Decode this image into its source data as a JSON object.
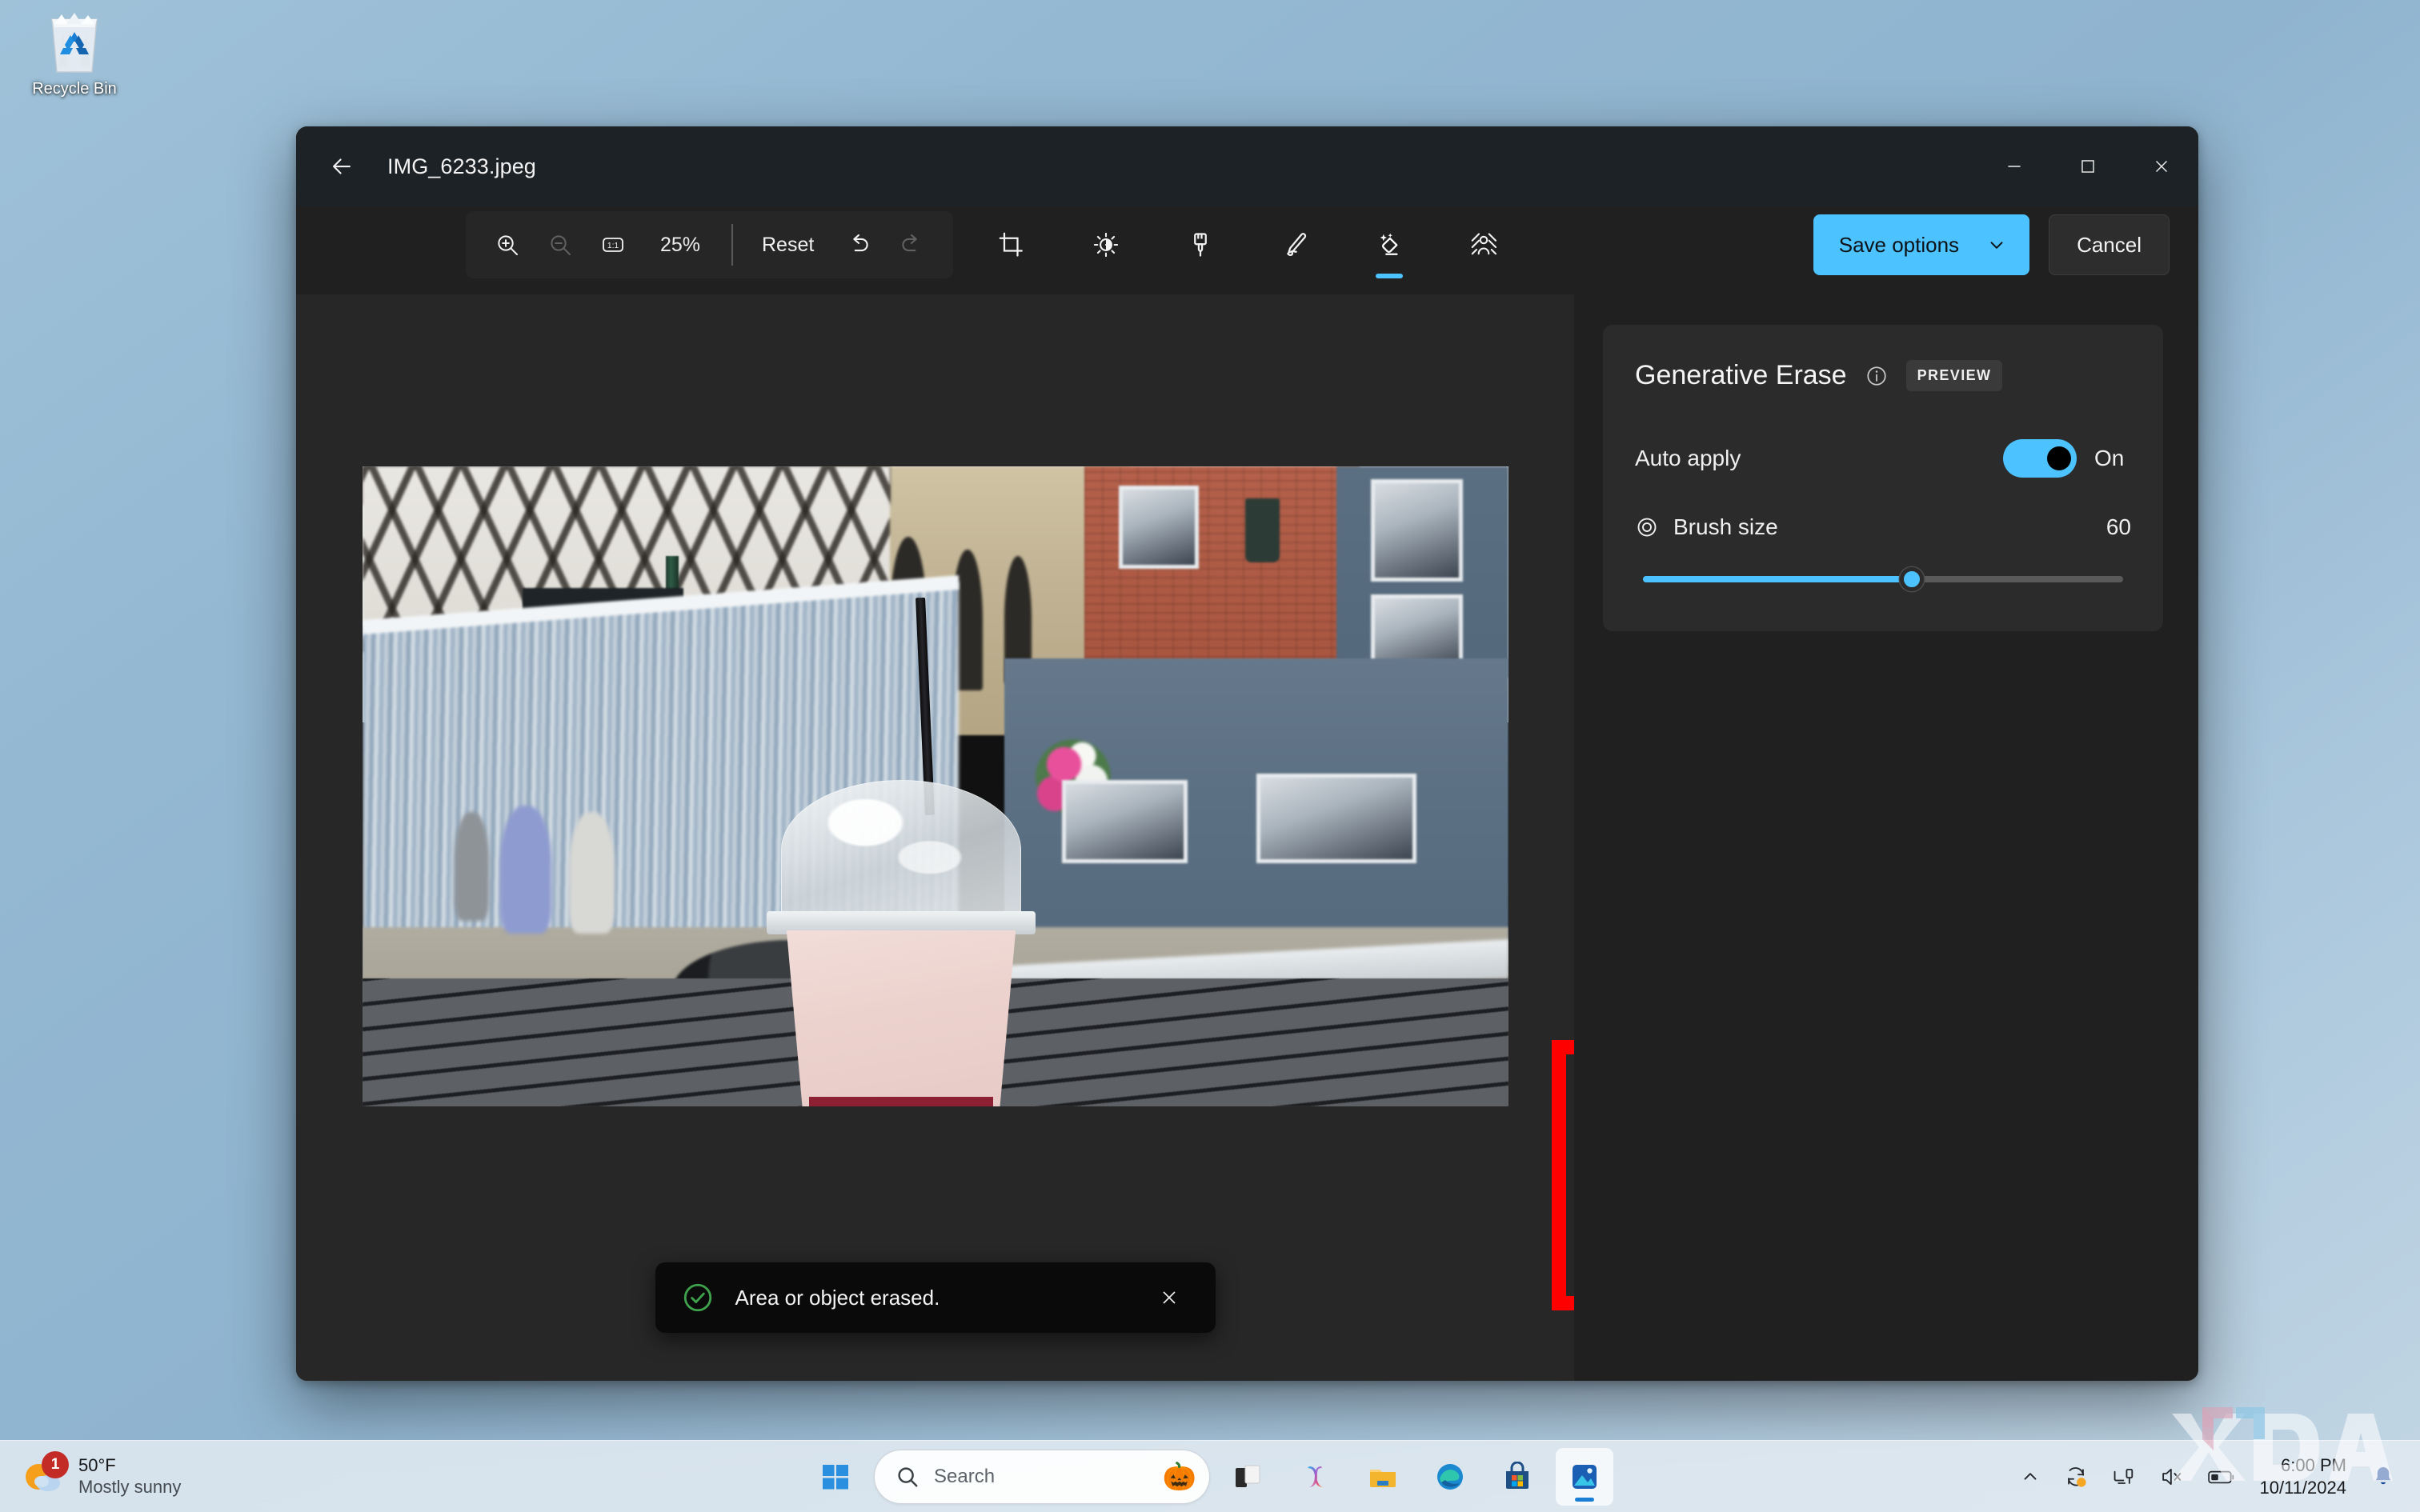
{
  "desktop": {
    "icons": [
      {
        "name": "recycle-bin",
        "label": "Recycle Bin"
      }
    ]
  },
  "window": {
    "title": "IMG_6233.jpeg",
    "back_icon": "back-arrow-icon",
    "controls": {
      "minimize": "minimize-icon",
      "maximize": "maximize-icon",
      "close": "close-icon"
    }
  },
  "toolbar": {
    "zoom_in": "zoom-in-icon",
    "zoom_out": "zoom-out-icon",
    "actual_size": "1:1",
    "zoom_level": "25%",
    "reset_label": "Reset",
    "undo_icon": "undo-icon",
    "redo_icon": "redo-icon",
    "tools": [
      {
        "name": "crop",
        "icon": "crop-icon",
        "active": false
      },
      {
        "name": "adjustment",
        "icon": "brightness-icon",
        "active": false
      },
      {
        "name": "filter",
        "icon": "paintbrush-icon",
        "active": false
      },
      {
        "name": "markup",
        "icon": "pen-icon",
        "active": false
      },
      {
        "name": "generative-erase",
        "icon": "magic-erase-icon",
        "active": true
      },
      {
        "name": "background-blur",
        "icon": "background-blur-icon",
        "active": false
      }
    ],
    "save_label": "Save options",
    "save_chevron": "chevron-down-icon",
    "cancel_label": "Cancel"
  },
  "panel": {
    "title": "Generative Erase",
    "info_icon": "info-icon",
    "badge": "PREVIEW",
    "auto_apply_label": "Auto apply",
    "auto_apply_state": "On",
    "auto_apply_on": true,
    "brush_icon": "brush-size-icon",
    "brush_label": "Brush size",
    "brush_value": "60",
    "brush_percent": 56
  },
  "toast": {
    "status_icon": "success-check-icon",
    "message": "Area or object erased.",
    "close_icon": "close-icon"
  },
  "canvas": {
    "annotation": "red-highlight-box",
    "brush_cursor": "brush-cursor-circle",
    "photo_description": "Milkshake in a clear plastic cup on a grey slatted outdoor table, blurred English street with construction hoarding, Tudor building, stone church and blue pub frontage"
  },
  "taskbar": {
    "weather": {
      "temperature": "50°F",
      "condition": "Mostly sunny",
      "badge": "1",
      "icon": "sun-cloud-icon"
    },
    "start_icon": "windows-start-icon",
    "search": {
      "placeholder": "Search",
      "icon": "search-icon",
      "decoration": "🎃"
    },
    "apps": [
      {
        "name": "task-view",
        "icon": "task-view-icon",
        "active": false
      },
      {
        "name": "copilot",
        "icon": "copilot-icon",
        "active": false
      },
      {
        "name": "file-explorer",
        "icon": "folder-icon",
        "active": false
      },
      {
        "name": "edge",
        "icon": "edge-icon",
        "active": false
      },
      {
        "name": "microsoft-store",
        "icon": "store-icon",
        "active": false
      },
      {
        "name": "photos",
        "icon": "photos-icon",
        "active": true
      }
    ],
    "tray": [
      {
        "name": "show-hidden-icons",
        "icon": "chevron-up-icon"
      },
      {
        "name": "onedrive-sync",
        "icon": "sync-icon"
      },
      {
        "name": "network",
        "icon": "network-icon"
      },
      {
        "name": "volume-muted",
        "icon": "speaker-muted-icon"
      },
      {
        "name": "battery",
        "icon": "battery-icon"
      }
    ],
    "clock": {
      "time": "6:00 PM",
      "date": "10/11/2024"
    },
    "notifications_icon": "bell-icon"
  },
  "watermark": {
    "text": "XDA"
  },
  "colors": {
    "accent": "#4cc2ff",
    "annotation_red": "#ff0000",
    "success_green": "#3fa34d",
    "window_bg": "#202020",
    "titlebar_bg": "#1d2226",
    "panel_card": "#2b2b2b",
    "canvas_bg": "#272727"
  }
}
